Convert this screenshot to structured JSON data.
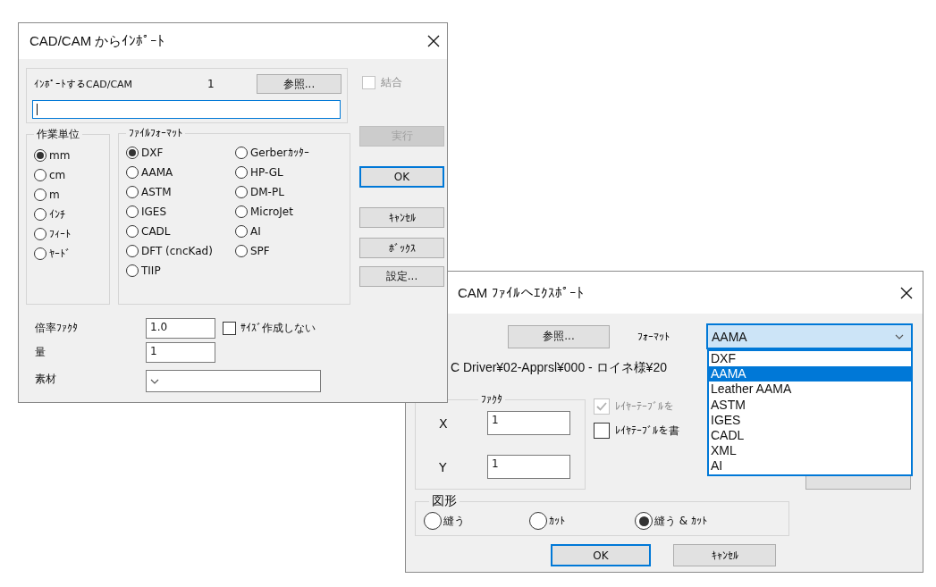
{
  "export_dialog": {
    "title": "CAM ﾌｧｲﾙへｴｸｽﾎﾟｰﾄ",
    "browse_button": "参照...",
    "format": {
      "label": "ﾌｫｰﾏｯﾄ",
      "value": "AAMA",
      "expanded": true,
      "options": [
        {
          "label": "DXF",
          "selected": false
        },
        {
          "label": "AAMA",
          "selected": true
        },
        {
          "label": "Leather AAMA",
          "selected": false
        },
        {
          "label": "ASTM",
          "selected": false
        },
        {
          "label": "IGES",
          "selected": false
        },
        {
          "label": "CADL",
          "selected": false
        },
        {
          "label": "XML",
          "selected": false
        },
        {
          "label": "AI",
          "selected": false
        }
      ]
    },
    "path_field": {
      "value": "C Driver¥02-Apprsl¥000 - ロイネ様¥20"
    },
    "factor": {
      "title": "ﾌｧｸﾀ",
      "fields": [
        {
          "label": "X",
          "value": "1"
        },
        {
          "label": "Y",
          "value": "1"
        }
      ]
    },
    "layer_checkboxes": [
      {
        "label": "ﾚｲﾔｰﾃｰﾌﾞﾙを",
        "checked": true,
        "disabled": true
      },
      {
        "label": "ﾚｲﾔﾃｰﾌﾞﾙを書",
        "checked": false,
        "disabled": false
      }
    ],
    "shape": {
      "title": "図形",
      "options": [
        {
          "label": "縫う",
          "selected": false
        },
        {
          "label": "ｶｯﾄ",
          "selected": false
        },
        {
          "label": "縫う & ｶｯﾄ",
          "selected": true
        }
      ]
    },
    "buttons": [
      {
        "label": "OK",
        "default": true
      },
      {
        "label": "ｷｬﾝｾﾙ",
        "default": false
      }
    ]
  },
  "import_dialog": {
    "title": "CAD/CAM からｲﾝﾎﾟｰﾄ",
    "source_label": "ｲﾝﾎﾟｰﾄするCAD/CAM",
    "count": "1",
    "browse_button": "参照...",
    "path_field": {
      "focused": true
    },
    "merge_checkbox": {
      "label": "結合",
      "checked": false,
      "disabled": true
    },
    "units": {
      "title": "作業単位",
      "options": [
        {
          "label": "mm",
          "selected": true
        },
        {
          "label": "cm",
          "selected": false
        },
        {
          "label": "m",
          "selected": false
        },
        {
          "label": "ｲﾝﾁ",
          "selected": false
        },
        {
          "label": "ﾌｨｰﾄ",
          "selected": false
        },
        {
          "label": "ﾔｰﾄﾞ",
          "selected": false
        }
      ]
    },
    "file_format": {
      "title": "ﾌｧｲﾙﾌｫｰﾏｯﾄ",
      "columns": [
        {
          "options": [
            {
              "label": "DXF",
              "selected": true
            },
            {
              "label": "AAMA",
              "selected": false
            },
            {
              "label": "ASTM",
              "selected": false
            },
            {
              "label": "IGES",
              "selected": false
            },
            {
              "label": "CADL",
              "selected": false
            },
            {
              "label": "DFT (cncKad)",
              "selected": false
            },
            {
              "label": "TIIP",
              "selected": false
            }
          ]
        },
        {
          "options": [
            {
              "label": "Gerberｶｯﾀｰ",
              "selected": false
            },
            {
              "label": "HP-GL",
              "selected": false
            },
            {
              "label": "DM-PL",
              "selected": false
            },
            {
              "label": "MicroJet",
              "selected": false
            },
            {
              "label": "AI",
              "selected": false
            },
            {
              "label": "SPF",
              "selected": false
            }
          ]
        }
      ]
    },
    "buttons": [
      {
        "label": "実行",
        "disabled": true,
        "default": false
      },
      {
        "label": "OK",
        "disabled": false,
        "default": true
      },
      {
        "label": "ｷｬﾝｾﾙ",
        "disabled": false,
        "default": false
      },
      {
        "label": "ﾎﾞｯｸｽ",
        "disabled": false,
        "default": false
      },
      {
        "label": "設定...",
        "disabled": false,
        "default": false
      }
    ],
    "scale_factor": {
      "label": "倍率ﾌｧｸﾀ",
      "value": "1.0"
    },
    "no_size_checkbox": {
      "label": "ｻｲｽﾞ作成しない",
      "checked": false,
      "disabled": false
    },
    "quantity": {
      "label": "量",
      "value": "1"
    },
    "material": {
      "label": "素材"
    }
  }
}
